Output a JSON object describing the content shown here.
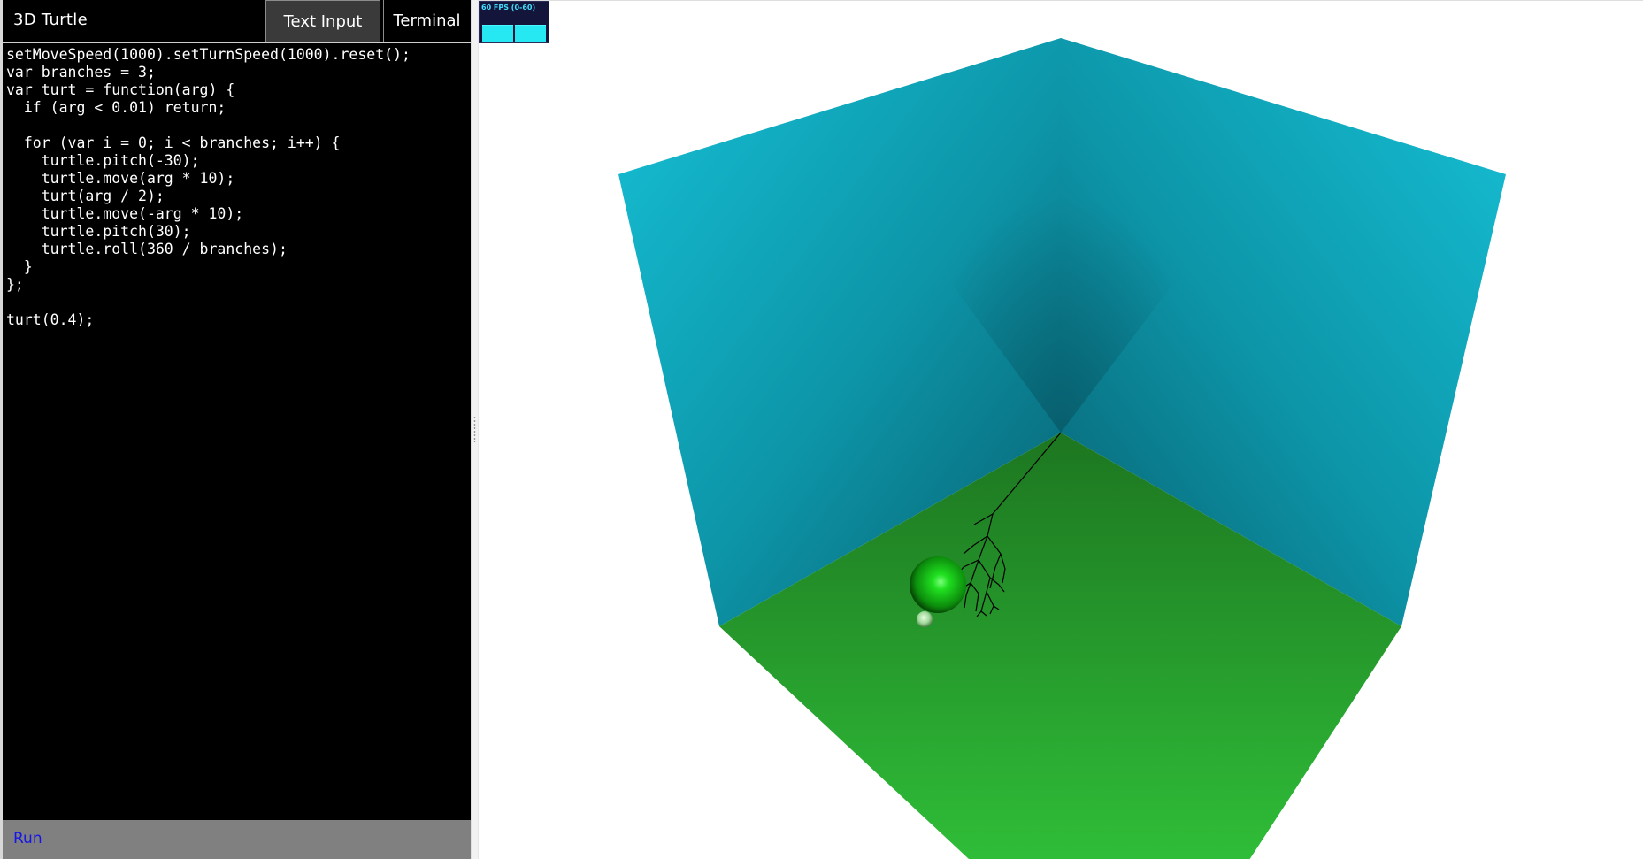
{
  "app": {
    "title": "3D Turtle"
  },
  "tabs": [
    {
      "label": "Text Input",
      "active": true
    },
    {
      "label": "Terminal",
      "active": false
    }
  ],
  "editor": {
    "code": "setMoveSpeed(1000).setTurnSpeed(1000).reset();\nvar branches = 3;\nvar turt = function(arg) {\n  if (arg < 0.01) return;\n\n  for (var i = 0; i < branches; i++) {\n    turtle.pitch(-30);\n    turtle.move(arg * 10);\n    turt(arg / 2);\n    turtle.move(-arg * 10);\n    turtle.pitch(30);\n    turtle.roll(360 / branches);\n  }\n};\n\nturt(0.4);"
  },
  "run_bar": {
    "run_label": "Run"
  },
  "stats": {
    "fps_label": "60 FPS (0-60)",
    "fps_value": 60,
    "fps_range": [
      0,
      60
    ]
  },
  "scene": {
    "background": "#ffffff",
    "wall_color_light": "#16c0d6",
    "wall_color_dark": "#07606f",
    "floor_color_light": "#2fbd38",
    "floor_color_dark": "#1d7620",
    "sphere_color": "#11cc11",
    "turtle_line_color": "#000000"
  }
}
